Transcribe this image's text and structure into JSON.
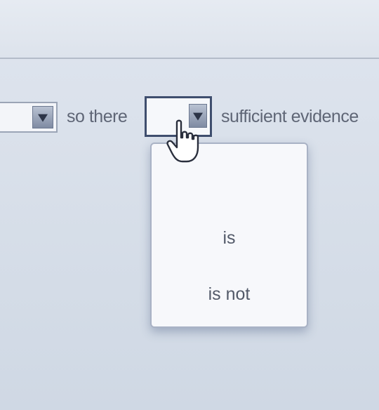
{
  "sentence": {
    "text_1": "so there",
    "text_2": "sufficient evidence"
  },
  "dropdown": {
    "options": [
      "is",
      "is not"
    ]
  },
  "icons": {
    "select_arrow": "triangle-down-icon",
    "cursor": "hand-pointer-icon"
  }
}
